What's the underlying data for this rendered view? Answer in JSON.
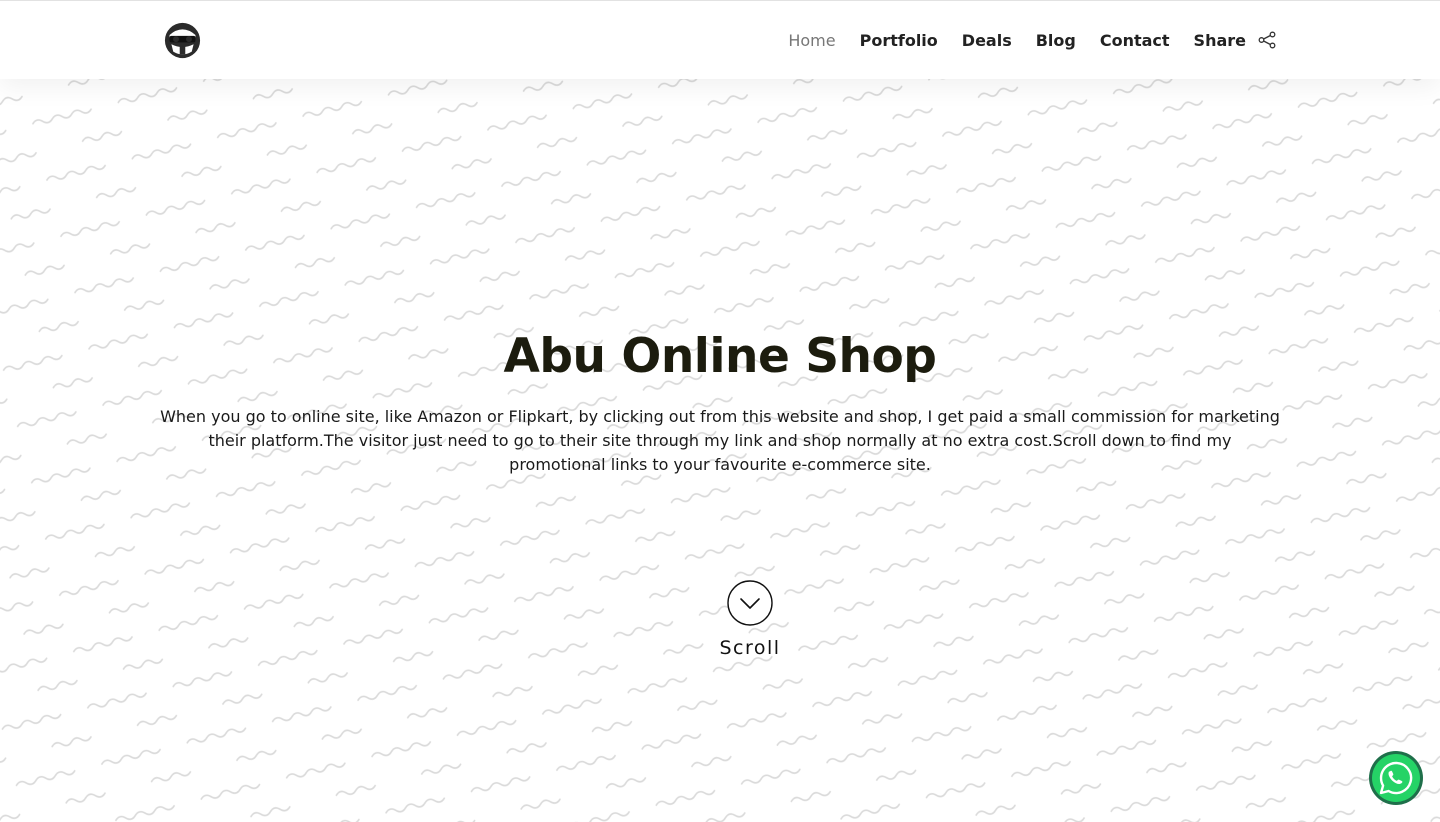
{
  "header": {
    "logo_icon": "masked-face-logo-icon",
    "nav": [
      {
        "label": "Home",
        "active": true
      },
      {
        "label": "Portfolio",
        "active": false
      },
      {
        "label": "Deals",
        "active": false
      },
      {
        "label": "Blog",
        "active": false
      },
      {
        "label": "Contact",
        "active": false
      }
    ],
    "share": {
      "label": "Share",
      "icon": "share-icon"
    }
  },
  "hero": {
    "title": "Abu Online Shop",
    "description": "When you go to online site, like Amazon or Flipkart, by clicking out from this website and shop, I get paid a small commission for marketing their platform.The visitor just need to go to their site through my link and shop normally at no extra cost.Scroll down to find my promotional links to your favourite e-commerce site.",
    "scroll_label": "Scroll",
    "scroll_icon": "chevron-down-circle-icon"
  },
  "floating": {
    "whatsapp_icon": "whatsapp-icon",
    "whatsapp_color": "#25d366",
    "whatsapp_ring_color": "#1f6f4a"
  },
  "colors": {
    "title": "#1c1c0e",
    "nav_active": "#777777",
    "nav": "#222222",
    "wave_pattern": "#d9d9d9"
  }
}
